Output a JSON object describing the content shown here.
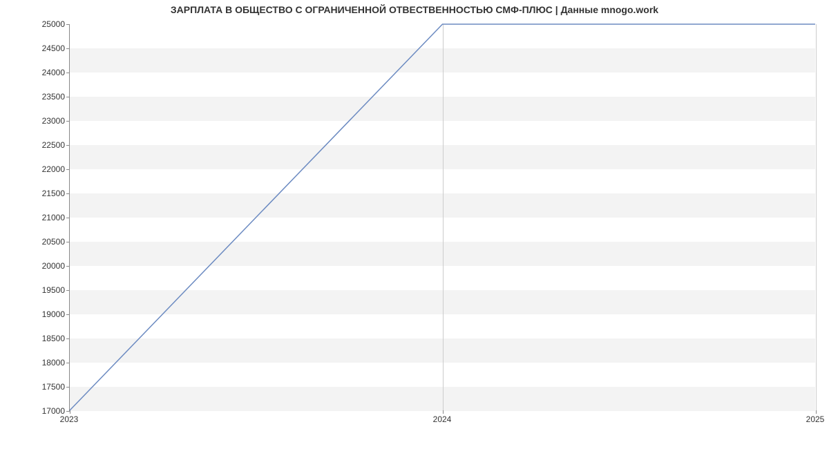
{
  "chart_data": {
    "type": "line",
    "title": "ЗАРПЛАТА В ОБЩЕСТВО С ОГРАНИЧЕННОЙ ОТВЕСТВЕННОСТЬЮ СМФ-ПЛЮС | Данные mnogo.work",
    "xlabel": "",
    "ylabel": "",
    "x": [
      2023,
      2024,
      2025
    ],
    "y": [
      17000,
      25000,
      25000
    ],
    "xticks": [
      2023,
      2024,
      2025
    ],
    "yticks": [
      17000,
      17500,
      18000,
      18500,
      19000,
      19500,
      20000,
      20500,
      21000,
      21500,
      22000,
      22500,
      23000,
      23500,
      24000,
      24500,
      25000
    ],
    "xlim": [
      2023,
      2025
    ],
    "ylim": [
      17000,
      25000
    ],
    "line_color": "#6b8ac1",
    "band_color": "#f3f3f3"
  }
}
